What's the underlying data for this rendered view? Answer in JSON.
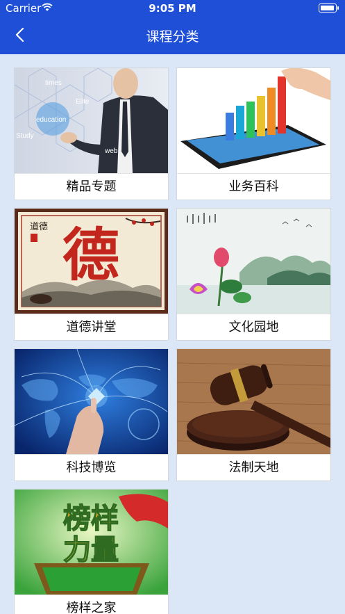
{
  "status": {
    "carrier": "Carrier",
    "time": "9:05 PM",
    "battery_level": 1.0
  },
  "nav": {
    "title": "课程分类"
  },
  "thumb_text": {
    "elite": {
      "w1": "times",
      "w2": "Elite",
      "w3": "education",
      "w4": "Study",
      "w5": "web"
    },
    "moral": {
      "char": "德",
      "seal": "道德"
    },
    "role": {
      "line1": "榜样",
      "line2": "力量"
    }
  },
  "categories": [
    {
      "label": "精品专题",
      "icon": "businessman-network-image"
    },
    {
      "label": "业务百科",
      "icon": "tablet-bar-chart-image"
    },
    {
      "label": "道德讲堂",
      "icon": "calligraphy-de-image"
    },
    {
      "label": "文化园地",
      "icon": "lotus-landscape-image"
    },
    {
      "label": "科技博览",
      "icon": "tech-globe-hand-image"
    },
    {
      "label": "法制天地",
      "icon": "judge-gavel-image"
    },
    {
      "label": "榜样之家",
      "icon": "role-model-power-image"
    }
  ]
}
